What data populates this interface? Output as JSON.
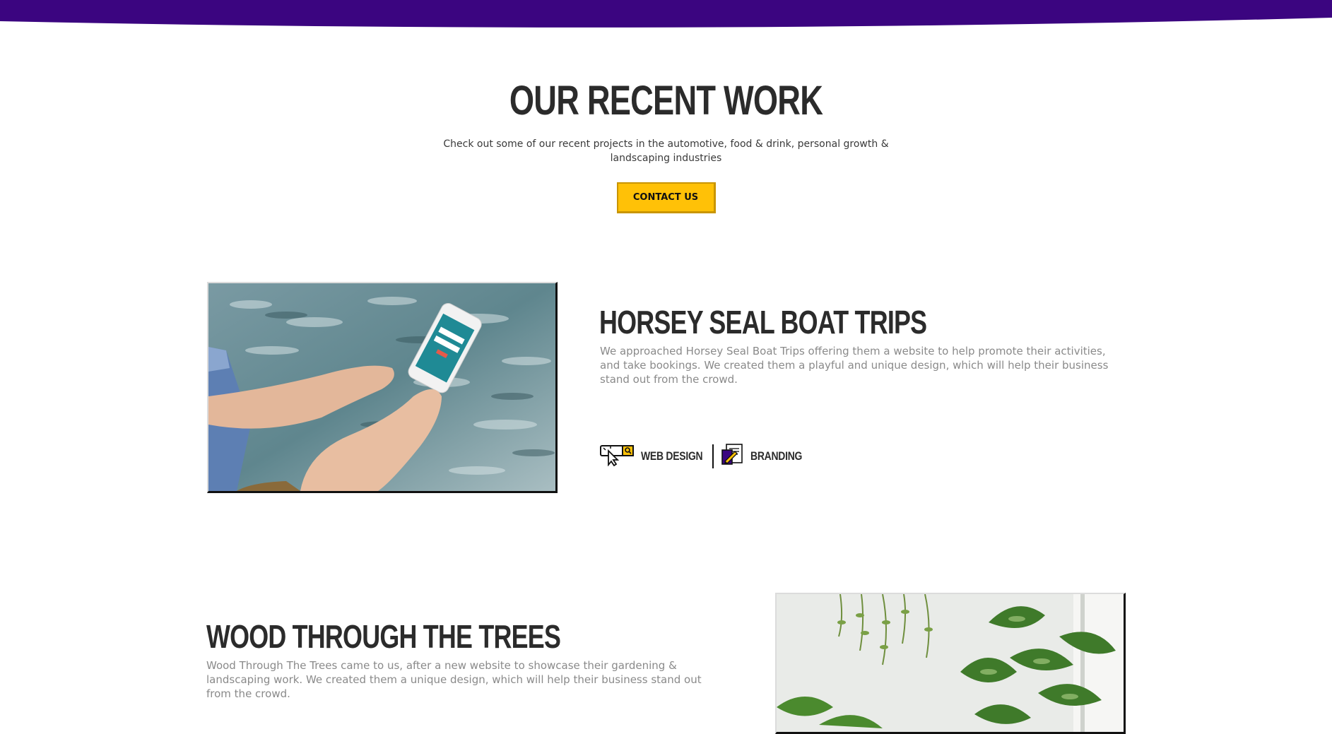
{
  "colors": {
    "banner": "#3b0580",
    "accent": "#ffc107",
    "heading": "#2b2b2b",
    "body_text": "#8a8a8a"
  },
  "intro": {
    "title": "OUR RECENT WORK",
    "text": "Check out some of our recent projects in the automotive, food & drink, personal growth & landscaping industries",
    "contact_button": "CONTACT US"
  },
  "projects": [
    {
      "title": "HORSEY SEAL BOAT TRIPS",
      "description": "We approached Horsey Seal Boat Trips offering them a website to help promote their activities, and take bookings. We created them a playful and unique design, which will help their business stand out from the crowd.",
      "tags": [
        {
          "icon": "web-design-icon",
          "label": "WEB DESIGN"
        },
        {
          "icon": "branding-icon",
          "label": "BRANDING"
        }
      ]
    },
    {
      "title": "WOOD THROUGH THE TREES",
      "description": "Wood Through The Trees came to us, after a new website to showcase their gardening & landscaping work. We created them a unique design, which will help their business stand out from the crowd."
    }
  ]
}
